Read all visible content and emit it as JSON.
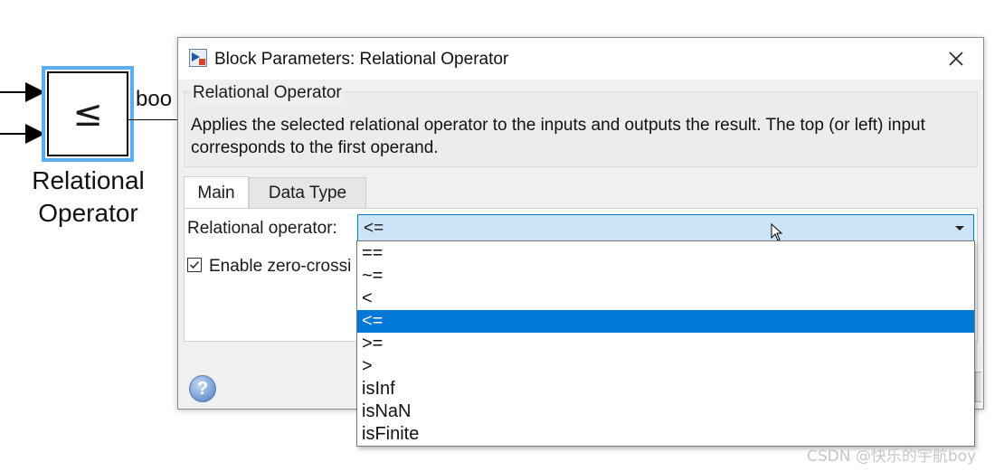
{
  "canvas": {
    "block_symbol": "≤",
    "block_name": "Relational\nOperator",
    "block_name_line1": "Relational",
    "block_name_line2": "Operator",
    "output_signal_label": "boo"
  },
  "dialog": {
    "title": "Block Parameters: Relational Operator",
    "group_title": "Relational Operator",
    "description": "Applies the selected relational operator to the inputs and outputs the result. The top (or left) input corresponds to the first operand.",
    "tabs": [
      {
        "label": "Main",
        "active": true
      },
      {
        "label": "Data Type",
        "active": false
      }
    ],
    "relational_operator_label": "Relational operator:",
    "relational_operator_value": "<=",
    "zero_crossing_label": "Enable zero-crossi",
    "zero_crossing_checked": true,
    "help_icon": "question-mark-icon"
  },
  "dropdown": {
    "options": [
      "==",
      "~=",
      "<",
      "<=",
      ">=",
      ">",
      "isInf",
      "isNaN",
      "isFinite"
    ],
    "selected": "<="
  },
  "watermark": "CSDN @快乐的宇航boy",
  "colors": {
    "selection_blue": "#0078d7",
    "combo_highlight": "#cce4f7",
    "block_selection_border": "#5aaef0"
  }
}
